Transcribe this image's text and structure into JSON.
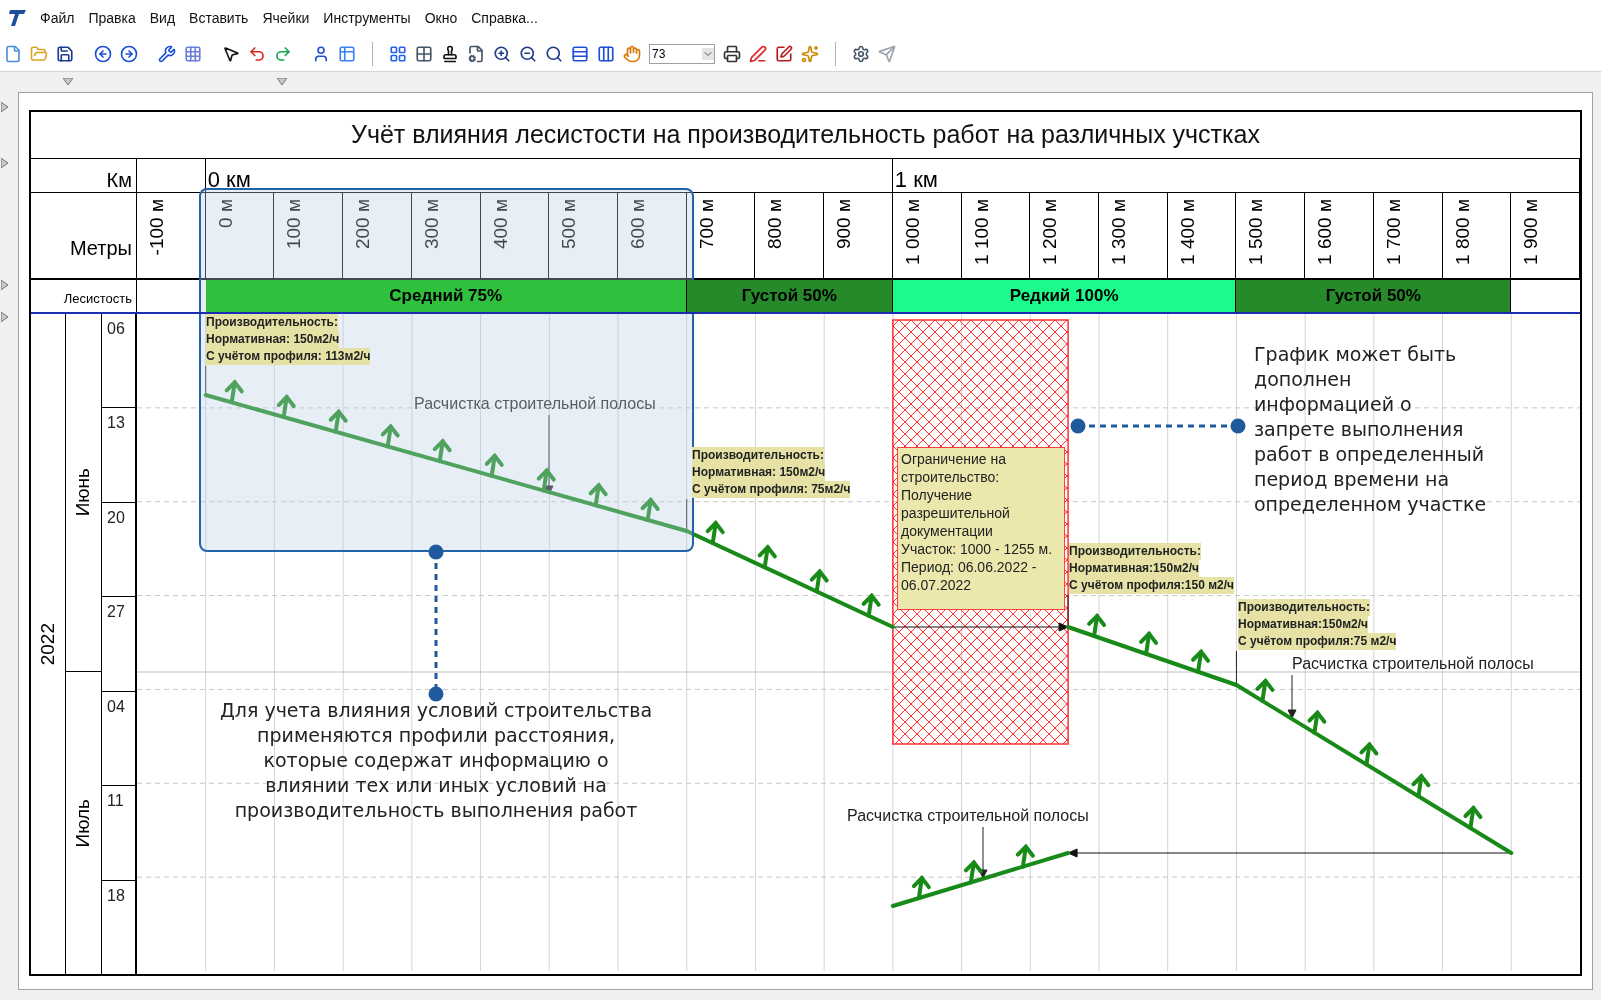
{
  "menu": [
    "Файл",
    "Правка",
    "Вид",
    "Вставить",
    "Ячейки",
    "Инструменты",
    "Окно",
    "Справка..."
  ],
  "toolbar": {
    "zoom": {
      "value": "73"
    }
  },
  "schedule": {
    "title": "Учёт влияния лесистости на производительность работ на различных учстках",
    "km_label": "Км",
    "meters_label": "Метры",
    "forest_label": "Лесистость",
    "km_marks": [
      "0 км",
      "1 км"
    ],
    "meters": [
      "-100 м",
      "0 м",
      "100 м",
      "200 м",
      "300 м",
      "400 м",
      "500 м",
      "600 м",
      "700 м",
      "800 м",
      "900 м",
      "1 000 м",
      "1 100 м",
      "1 200 м",
      "1 300 м",
      "1 400 м",
      "1 500 м",
      "1 600 м",
      "1 700 м",
      "1 800 м",
      "1 900 м"
    ],
    "forest": [
      {
        "label": "Средний 75%",
        "color": "#2fc13e"
      },
      {
        "label": "Густой 50%",
        "color": "#26892a"
      },
      {
        "label": "Редкий 100%",
        "color": "#1cfc8c"
      },
      {
        "label": "Густой 50%",
        "color": "#26892a"
      }
    ],
    "year": "2022",
    "months": [
      "Июнь",
      "Июль"
    ],
    "days": [
      "06",
      "13",
      "20",
      "27",
      "04",
      "11",
      "18"
    ],
    "productivity_notes": [
      {
        "lines": [
          "Производительность:",
          "Нормативная: 150м2/ч",
          "С учётом профиля: 113м2/ч"
        ]
      },
      {
        "lines": [
          "Производительность:",
          "Нормативная: 150м2/ч",
          "С учётом профиля: 75м2/ч"
        ]
      },
      {
        "lines": [
          "Производительность:",
          "Нормативная:150м2/ч",
          "С учётом профиля:150 м2/ч"
        ]
      },
      {
        "lines": [
          "Производительность:",
          "Нормативная:150м2/ч",
          "С учётом профиля:75 м2/ч"
        ]
      }
    ],
    "work_labels": [
      "Расчистка строительной полосы",
      "Расчистка строительной полосы",
      "Расчистка строительной полосы"
    ],
    "restriction": {
      "text": "Ограничение на\nстроительство:\nПолучение\nразрешительной\nдокументации\nУчасток: 1000 - 1255 м.\nПериод: 06.06.2022 -\n06.07.2022"
    },
    "callouts": [
      {
        "text": "Для учета влияния условий строительства\nприменяются профили расстояния,\nкоторые содержат информацию о\nвлиянии тех или иных условий на\nпроизводительность выполнения работ"
      },
      {
        "text": "График может быть\nдополнен\nинформацией о\nзапрете выполнения\nработ в определенный\nпериод времени на\nопределенном участке"
      }
    ]
  }
}
